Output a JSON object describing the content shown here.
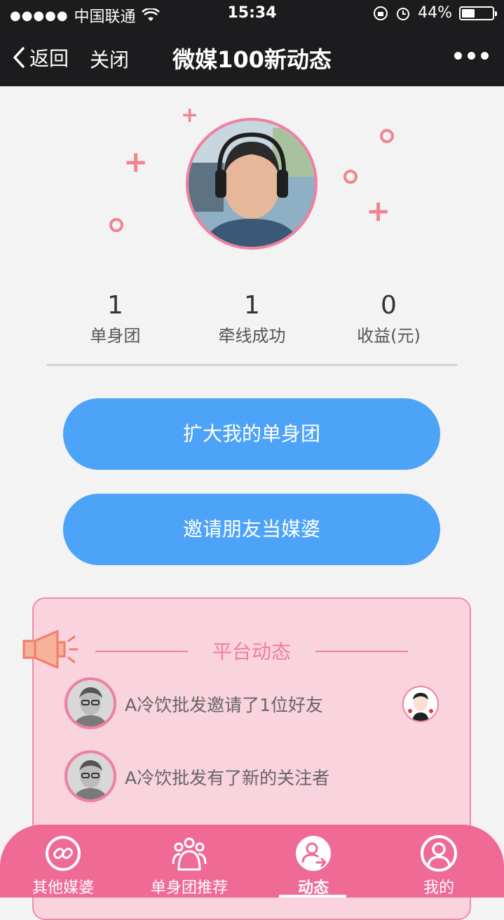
{
  "status_bar": {
    "carrier": "中国联通",
    "time": "15:34",
    "battery": "44%",
    "battery_level": 0.44
  },
  "navbar": {
    "back_label": "返回",
    "close_label": "关闭",
    "title": "微媒100新动态"
  },
  "stats": [
    {
      "value": "1",
      "label": "单身团"
    },
    {
      "value": "1",
      "label": "牵线成功"
    },
    {
      "value": "0",
      "label": "收益(元)"
    }
  ],
  "buttons": {
    "expand": "扩大我的单身团",
    "invite": "邀请朋友当媒婆"
  },
  "platform": {
    "title": "平台动态",
    "items": [
      {
        "text": "A冷饮批发邀请了1位好友"
      },
      {
        "text": "A冷饮批发有了新的关注者"
      }
    ]
  },
  "tabs": [
    {
      "label": "其他媒婆",
      "icon": "link-icon"
    },
    {
      "label": "单身团推荐",
      "icon": "group-icon"
    },
    {
      "label": "动态",
      "icon": "user-share-icon",
      "active": true
    },
    {
      "label": "我的",
      "icon": "profile-icon"
    }
  ],
  "colors": {
    "accent_blue": "#4da3f8",
    "accent_pink": "#f06a96",
    "panel_pink": "#f9d3de"
  }
}
